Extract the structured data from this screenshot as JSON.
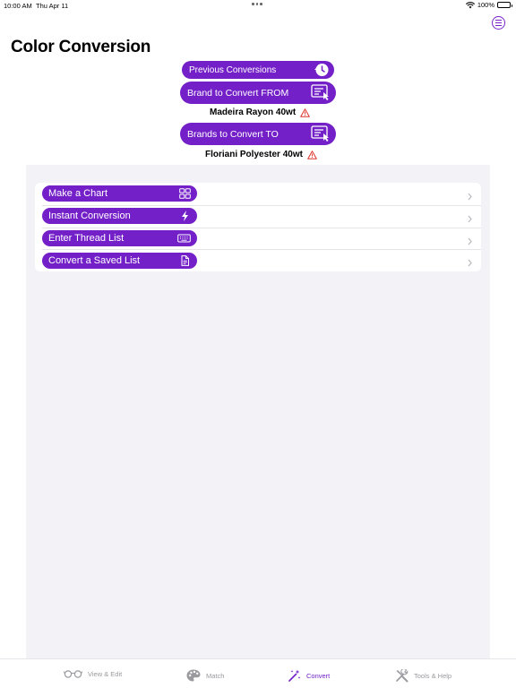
{
  "status": {
    "time": "10:00 AM",
    "date": "Thu Apr 11",
    "battery": "100%"
  },
  "header": {
    "title": "Color Conversion",
    "menu_icon": "list-circle-icon"
  },
  "actions": {
    "previous_conversions": "Previous Conversions",
    "brand_from": "Brand to Convert FROM",
    "brand_from_value": "Madeira Rayon 40wt",
    "brand_to": "Brands to Convert TO",
    "brand_to_value": "Floriani Polyester 40wt"
  },
  "list": {
    "items": [
      {
        "label": "Make a Chart",
        "icon": "grid-icon"
      },
      {
        "label": "Instant Conversion",
        "icon": "bolt-icon"
      },
      {
        "label": "Enter Thread List",
        "icon": "keyboard-icon"
      },
      {
        "label": "Convert a Saved List",
        "icon": "document-icon"
      }
    ]
  },
  "tabs": [
    {
      "label": "View & Edit",
      "icon": "eyeglasses-icon",
      "active": false
    },
    {
      "label": "Match",
      "icon": "palette-icon",
      "active": false
    },
    {
      "label": "Convert",
      "icon": "magic-wand-icon",
      "active": true
    },
    {
      "label": "Tools & Help",
      "icon": "tools-icon",
      "active": false
    }
  ],
  "colors": {
    "accent": "#7420c8",
    "warning": "#e0302a",
    "panel_bg": "#f2f2f7",
    "tab_inactive": "#9a9a9f"
  }
}
